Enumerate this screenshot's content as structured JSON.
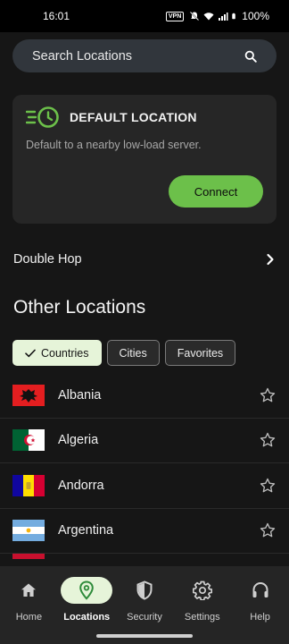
{
  "status": {
    "time": "16:01",
    "vpn": "VPN",
    "battery": "100%"
  },
  "search": {
    "placeholder": "Search Locations",
    "icon": "search-icon"
  },
  "default_location": {
    "title": "DEFAULT LOCATION",
    "subtitle": "Default to a nearby low-load server.",
    "connect_label": "Connect",
    "icon": "fast-clock-icon",
    "accent": "#6cc04a"
  },
  "double_hop": {
    "label": "Double Hop",
    "icon": "chevron-right-icon"
  },
  "other_locations": {
    "title": "Other Locations",
    "filters": [
      {
        "label": "Countries",
        "active": true
      },
      {
        "label": "Cities",
        "active": false
      },
      {
        "label": "Favorites",
        "active": false
      }
    ],
    "countries": [
      {
        "name": "Albania",
        "flag": "albania-flag",
        "favorite": false
      },
      {
        "name": "Algeria",
        "flag": "algeria-flag",
        "favorite": false
      },
      {
        "name": "Andorra",
        "flag": "andorra-flag",
        "favorite": false
      },
      {
        "name": "Argentina",
        "flag": "argentina-flag",
        "favorite": false
      }
    ]
  },
  "nav": {
    "items": [
      {
        "label": "Home",
        "icon": "home-icon",
        "active": false
      },
      {
        "label": "Locations",
        "icon": "location-pin-icon",
        "active": true
      },
      {
        "label": "Security",
        "icon": "shield-icon",
        "active": false
      },
      {
        "label": "Settings",
        "icon": "gear-icon",
        "active": false
      },
      {
        "label": "Help",
        "icon": "headset-icon",
        "active": false
      }
    ],
    "active_color": "#e6f4d9"
  }
}
